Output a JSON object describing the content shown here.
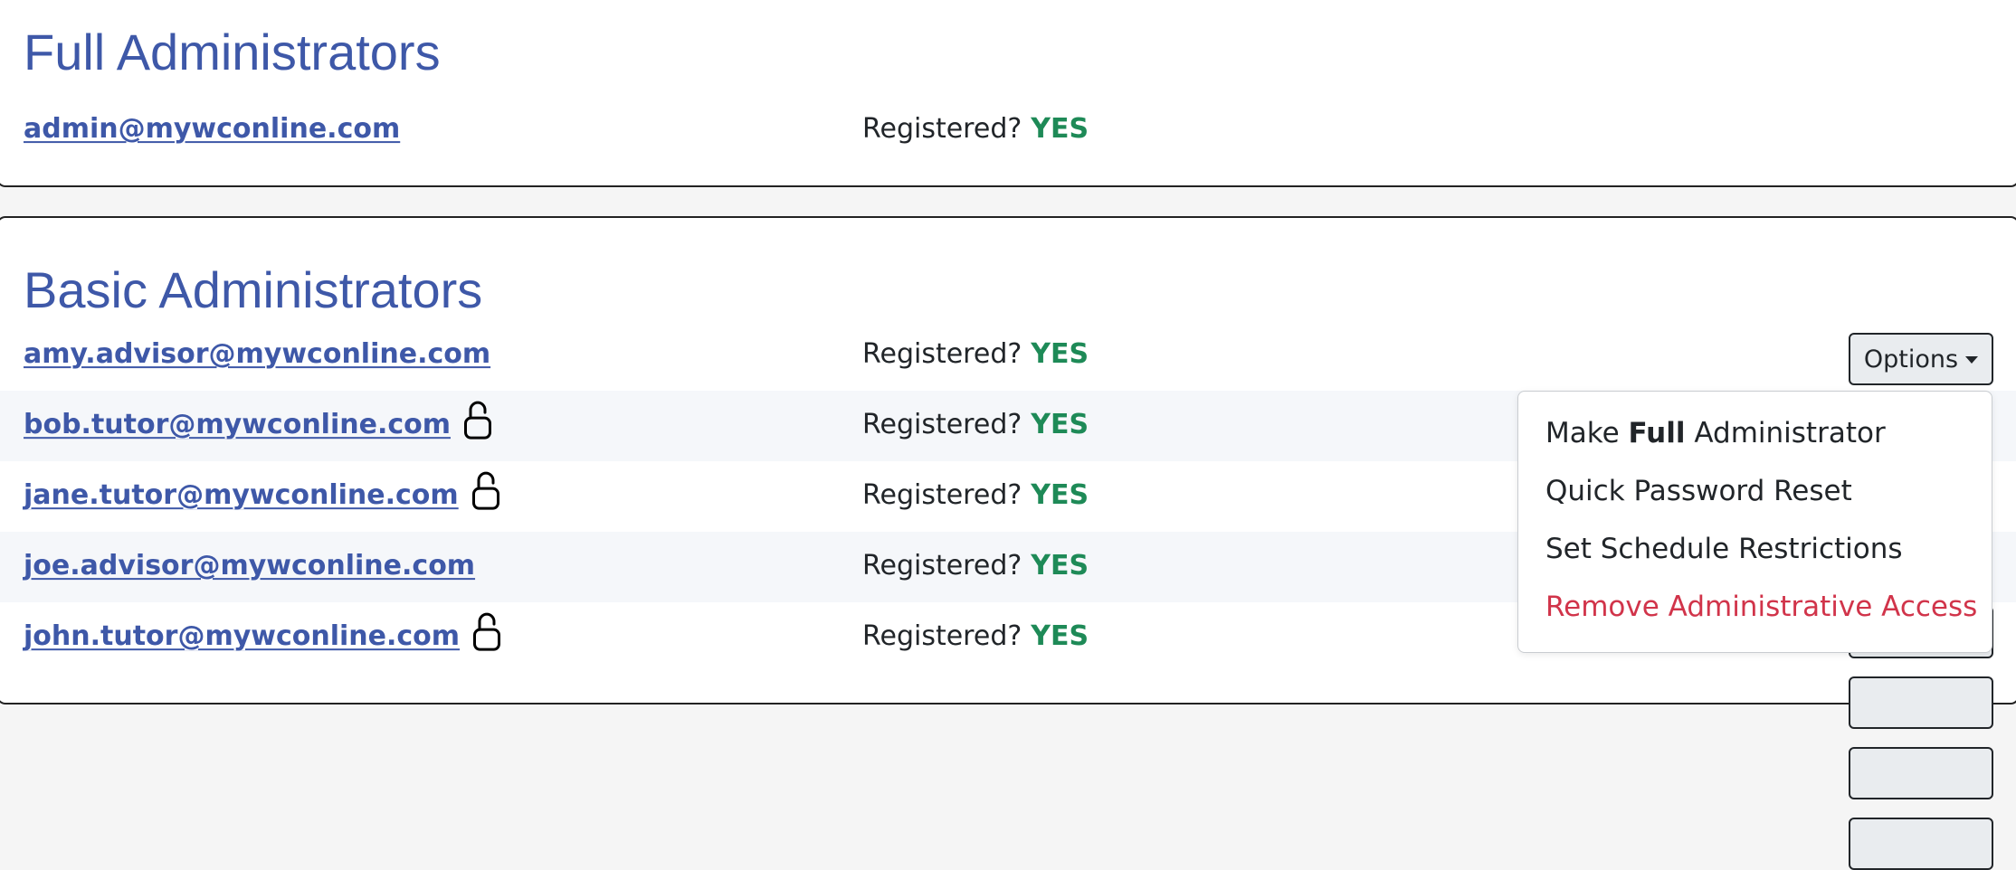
{
  "colors": {
    "heading": "#3e58a8",
    "link": "#3e58a8",
    "registered_yes": "#1e8a57",
    "danger": "#d1344a",
    "row_stripe": "#f5f7fa"
  },
  "full_section": {
    "title": "Full Administrators",
    "admins": [
      {
        "email": "admin@mywconline.com",
        "registered_label": "Registered?",
        "registered_value": "YES",
        "locked": false
      }
    ]
  },
  "basic_section": {
    "title": "Basic Administrators",
    "admins": [
      {
        "email": "amy.advisor@mywconline.com",
        "registered_label": "Registered?",
        "registered_value": "YES",
        "locked": false
      },
      {
        "email": "bob.tutor@mywconline.com",
        "registered_label": "Registered?",
        "registered_value": "YES",
        "locked": true,
        "lock_icon": "lock-icon"
      },
      {
        "email": "jane.tutor@mywconline.com",
        "registered_label": "Registered?",
        "registered_value": "YES",
        "locked": true,
        "lock_icon": "lock-icon"
      },
      {
        "email": "joe.advisor@mywconline.com",
        "registered_label": "Registered?",
        "registered_value": "YES",
        "locked": false
      },
      {
        "email": "john.tutor@mywconline.com",
        "registered_label": "Registered?",
        "registered_value": "YES",
        "locked": true,
        "lock_icon": "lock-icon"
      }
    ],
    "options_button": {
      "label": "Options",
      "icon": "caret-down-icon"
    }
  },
  "options_menu": {
    "make_full": {
      "prefix": "Make",
      "emphasis": "Full",
      "suffix": "Administrator"
    },
    "items": [
      {
        "label": "Quick Password Reset"
      },
      {
        "label": "Set Schedule Restrictions"
      },
      {
        "label": "Remove Administrative Access"
      }
    ]
  }
}
